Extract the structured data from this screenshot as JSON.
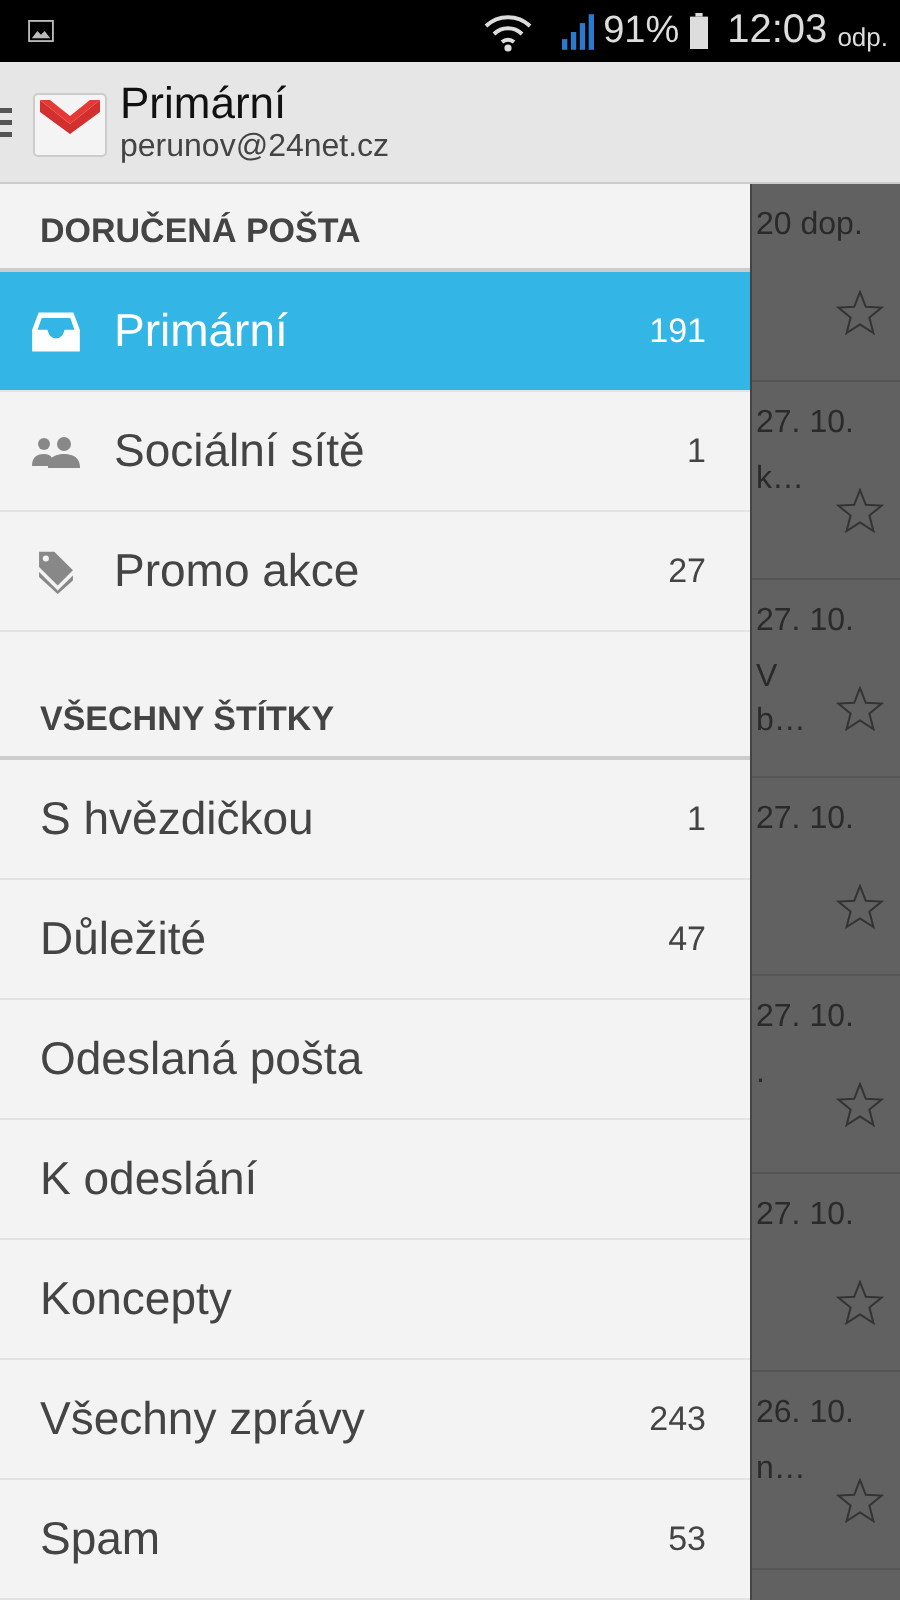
{
  "status_bar": {
    "battery": "91%",
    "time": "12:03",
    "time_suffix": "odp."
  },
  "app_bar": {
    "title": "Primární",
    "account": "perunov@24net.cz"
  },
  "drawer": {
    "sections": [
      {
        "title": "DORUČENÁ POŠTA",
        "items": [
          {
            "kind": "inbox",
            "label": "Primární",
            "count": "191",
            "selected": true
          },
          {
            "kind": "people",
            "label": "Sociální sítě",
            "count": "1",
            "selected": false
          },
          {
            "kind": "tag",
            "label": "Promo akce",
            "count": "27",
            "selected": false
          }
        ]
      },
      {
        "title": "VŠECHNY ŠTÍTKY",
        "items": [
          {
            "kind": "label",
            "label": "S hvězdičkou",
            "count": "1",
            "selected": false
          },
          {
            "kind": "label",
            "label": "Důležité",
            "count": "47",
            "selected": false
          },
          {
            "kind": "label",
            "label": "Odeslaná pošta",
            "selected": false
          },
          {
            "kind": "label",
            "label": "K odeslání",
            "selected": false
          },
          {
            "kind": "label",
            "label": "Koncepty",
            "selected": false
          },
          {
            "kind": "label",
            "label": "Všechny zprávy",
            "count": "243",
            "selected": false
          },
          {
            "kind": "label",
            "label": "Spam",
            "count": "53",
            "selected": false
          }
        ]
      }
    ]
  },
  "background_messages": [
    {
      "date": "20 dop.",
      "starred": false
    },
    {
      "date": "27. 10.",
      "lines": [
        "k…"
      ],
      "starred": false
    },
    {
      "date": "27. 10.",
      "lines": [
        "V",
        "b…"
      ],
      "starred": false
    },
    {
      "date": "27. 10.",
      "starred": false
    },
    {
      "date": "27. 10.",
      "lines": [
        "."
      ],
      "starred": false
    },
    {
      "date": "27. 10.",
      "starred": false
    },
    {
      "date": "26. 10.",
      "lines": [
        "n…"
      ],
      "starred": false
    }
  ]
}
